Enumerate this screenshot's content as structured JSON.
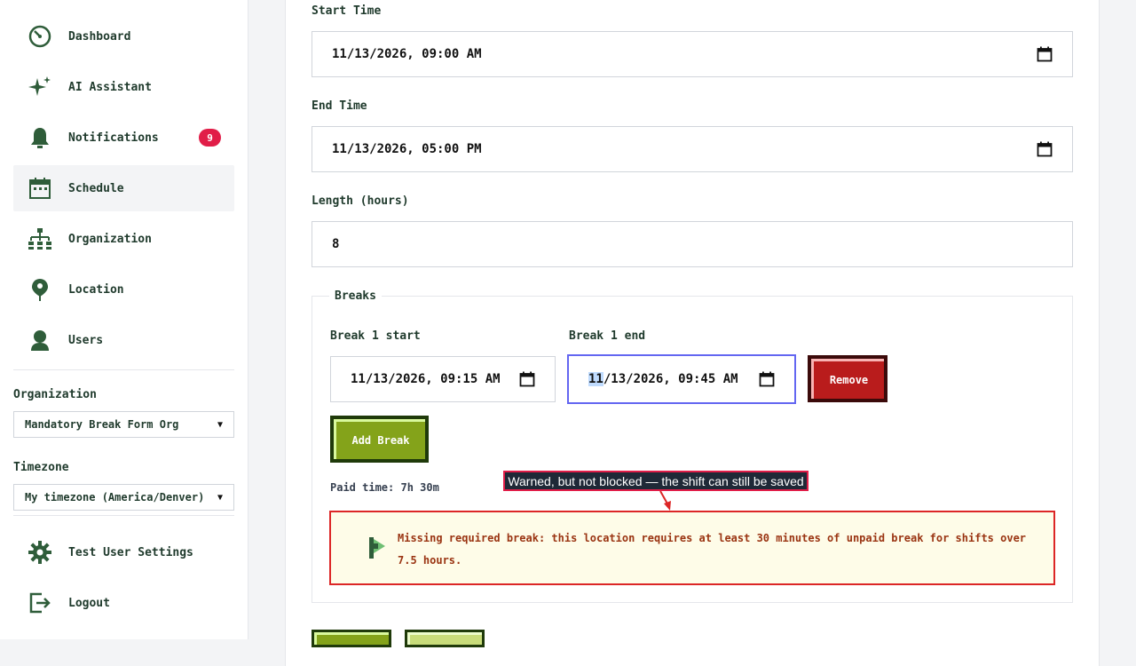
{
  "sidebar": {
    "nav": [
      {
        "label": "Dashboard",
        "icon": "dashboard-icon"
      },
      {
        "label": "AI Assistant",
        "icon": "sparkle-icon"
      },
      {
        "label": "Notifications",
        "icon": "bell-icon",
        "badge": "9"
      },
      {
        "label": "Schedule",
        "icon": "calendar-icon",
        "active": true
      },
      {
        "label": "Organization",
        "icon": "org-chart-icon"
      },
      {
        "label": "Location",
        "icon": "location-pin-icon"
      },
      {
        "label": "Users",
        "icon": "user-icon"
      }
    ],
    "organization": {
      "label": "Organization",
      "selected": "Mandatory Break Form Org"
    },
    "timezone": {
      "label": "Timezone",
      "selected": "My timezone (America/Denver)"
    },
    "bottom": [
      {
        "label": "Test User Settings",
        "icon": "gear-icon"
      },
      {
        "label": "Logout",
        "icon": "logout-icon"
      }
    ]
  },
  "form": {
    "start_time": {
      "label": "Start Time",
      "value": "11/13/2026, 09:00 AM"
    },
    "end_time": {
      "label": "End Time",
      "value": "11/13/2026, 05:00 PM"
    },
    "length": {
      "label": "Length (hours)",
      "value": "8"
    },
    "breaks": {
      "legend": "Breaks",
      "items": [
        {
          "start_label": "Break 1 start",
          "start_value": "11/13/2026, 09:15 AM",
          "end_label": "Break 1 end",
          "end_value_selected": "11",
          "end_value_rest": "/13/2026, 09:45 AM",
          "remove_label": "Remove"
        }
      ],
      "add_label": "Add Break",
      "paid_time": "Paid time: 7h 30m",
      "warning": "Missing required break: this location requires at least 30 minutes of unpaid break for shifts over 7.5 hours."
    }
  },
  "annotation": {
    "text": "Warned, but not blocked — the shift can still be saved"
  },
  "colors": {
    "accent_green": "#1f3a2c",
    "badge_red": "#e11d48",
    "remove_red": "#b91c1c",
    "add_green": "#84a31a",
    "warning_bg": "#fefce8",
    "warning_border": "#dc2626",
    "focus_blue": "#6366f1"
  }
}
